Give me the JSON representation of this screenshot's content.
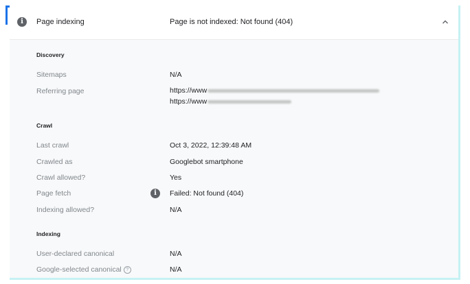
{
  "header": {
    "title": "Page indexing",
    "status": "Page is not indexed: Not found (404)",
    "info_icon": "info-icon",
    "toggle_icon": "chevron-up-icon"
  },
  "discovery": {
    "title": "Discovery",
    "sitemaps_label": "Sitemaps",
    "sitemaps_value": "N/A",
    "referring_label": "Referring page",
    "referring_1": "https://www",
    "referring_2": "https://www"
  },
  "crawl": {
    "title": "Crawl",
    "last_crawl_label": "Last crawl",
    "last_crawl_value": "Oct 3, 2022, 12:39:48 AM",
    "crawled_as_label": "Crawled as",
    "crawled_as_value": "Googlebot smartphone",
    "crawl_allowed_label": "Crawl allowed?",
    "crawl_allowed_value": "Yes",
    "page_fetch_label": "Page fetch",
    "page_fetch_value": "Failed: Not found (404)",
    "indexing_allowed_label": "Indexing allowed?",
    "indexing_allowed_value": "N/A"
  },
  "indexing": {
    "title": "Indexing",
    "user_canonical_label": "User-declared canonical",
    "user_canonical_value": "N/A",
    "google_canonical_label": "Google-selected canonical",
    "google_canonical_value": "N/A",
    "help_glyph": "?"
  },
  "colors": {
    "accent": "#1a73e8",
    "border": "#c6f1f4",
    "panel_bg": "#f8f9fa"
  }
}
